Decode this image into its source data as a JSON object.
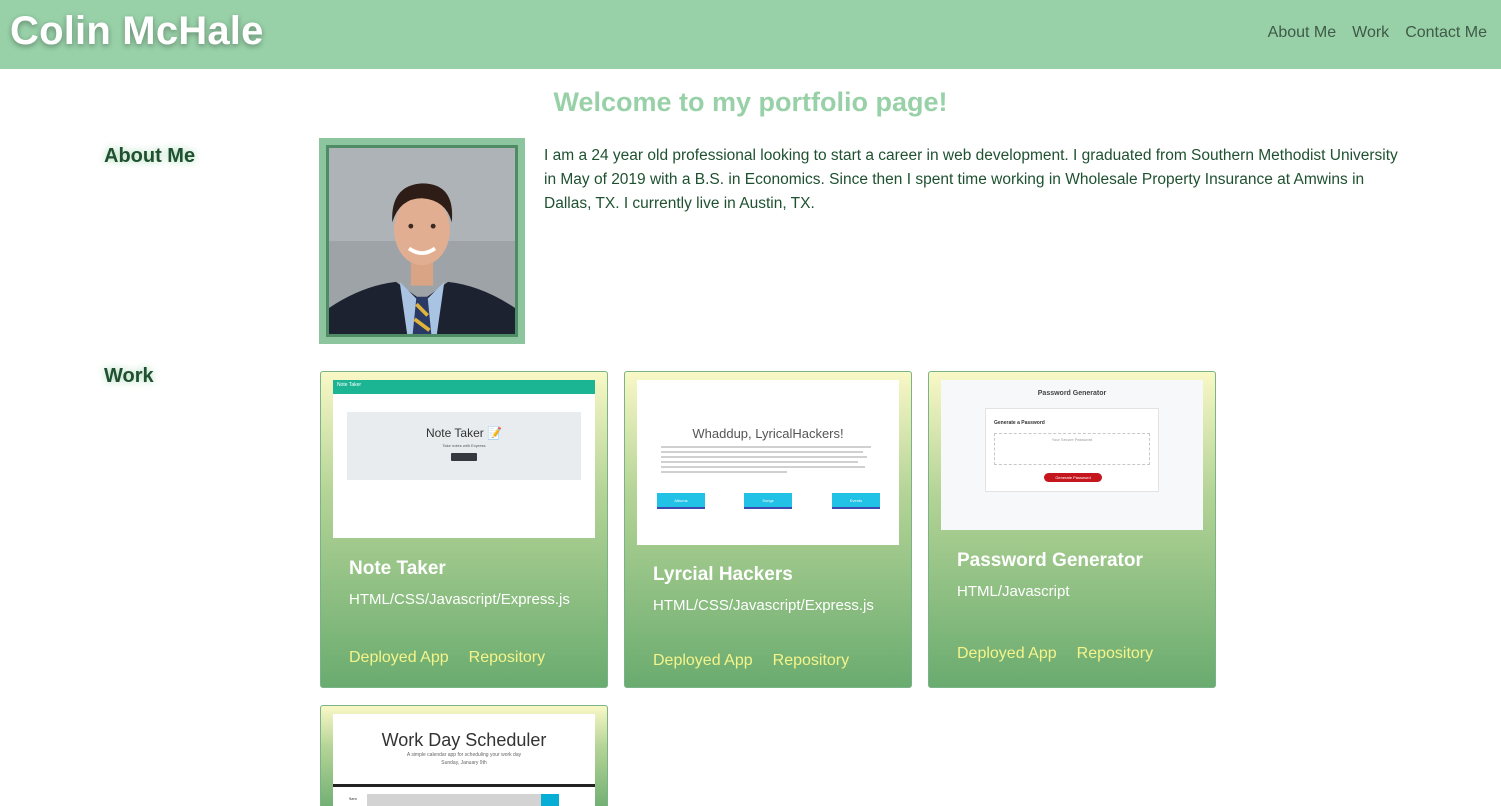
{
  "header": {
    "brand": "Colin McHale",
    "nav": [
      "About Me",
      "Work",
      "Contact Me"
    ]
  },
  "welcome": "Welcome to my portfolio page!",
  "about": {
    "label": "About Me",
    "text": "I am a 24 year old professional looking to start a career in web development. I graduated from Southern Methodist University in May of 2019 with a B.S. in Economics. Since then I spent time working in Wholesale Property Insurance at Amwins in Dallas, TX. I currently live in Austin, TX."
  },
  "work": {
    "label": "Work",
    "projects": [
      {
        "title": "Note Taker",
        "tech": "HTML/CSS/Javascript/Express.js",
        "deployed_label": "Deployed App",
        "repo_label": "Repository",
        "screenshot": {
          "nav": "Note Taker",
          "heading": "Note Taker 📝",
          "sub": "Take notes with Express"
        }
      },
      {
        "title": "Lyrcial Hackers",
        "tech": "HTML/CSS/Javascript/Express.js",
        "deployed_label": "Deployed App",
        "repo_label": "Repository",
        "screenshot": {
          "heading": "Whaddup, LyricalHackers!",
          "buttons": [
            "Albums",
            "Songs",
            "Events"
          ]
        }
      },
      {
        "title": "Password Generator",
        "tech": "HTML/Javascript",
        "deployed_label": "Deployed App",
        "repo_label": "Repository",
        "screenshot": {
          "heading": "Password Generator",
          "card_title": "Generate a Password",
          "placeholder": "Your Secure Password",
          "button": "Generate Password"
        }
      },
      {
        "title": "Work Day Scheduler",
        "screenshot": {
          "heading": "Work Day Scheduler",
          "sub": "A simple calendar app for scheduling your work day",
          "date": "Sunday, January 9th",
          "hour": "9am"
        }
      }
    ]
  },
  "colors": {
    "header_bg": "#98d1a8",
    "accent_text": "#1f5130",
    "link": "#f4f48a"
  }
}
